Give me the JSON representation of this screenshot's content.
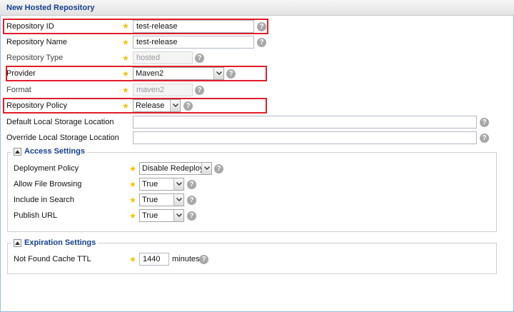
{
  "header": {
    "title": "New Hosted Repository"
  },
  "fields": {
    "repository_id": {
      "label": "Repository ID",
      "value": "test-release"
    },
    "repository_name": {
      "label": "Repository Name",
      "value": "test-release"
    },
    "repository_type": {
      "label": "Repository Type",
      "value": "hosted"
    },
    "provider": {
      "label": "Provider",
      "value": "Maven2"
    },
    "format": {
      "label": "Format",
      "value": "maven2"
    },
    "repository_policy": {
      "label": "Repository Policy",
      "value": "Release"
    },
    "default_storage": {
      "label": "Default Local Storage Location",
      "value": ""
    },
    "override_storage": {
      "label": "Override Local Storage Location",
      "value": ""
    }
  },
  "access_settings": {
    "title": "Access Settings",
    "deployment_policy": {
      "label": "Deployment Policy",
      "value": "Disable Redeploy"
    },
    "allow_file_browsing": {
      "label": "Allow File Browsing",
      "value": "True"
    },
    "include_in_search": {
      "label": "Include in Search",
      "value": "True"
    },
    "publish_url": {
      "label": "Publish URL",
      "value": "True"
    }
  },
  "expiration_settings": {
    "title": "Expiration Settings",
    "not_found_cache_ttl": {
      "label": "Not Found Cache TTL",
      "value": "1440",
      "unit": "minutes"
    }
  },
  "colors": {
    "highlight": "#e01e2b",
    "legend_text": "#15428b",
    "required_star": "#f5c400"
  },
  "icons": {
    "required": "star-icon",
    "help": "help-icon",
    "dropdown": "chevron-down-icon",
    "collapse": "collapse-up-icon"
  }
}
